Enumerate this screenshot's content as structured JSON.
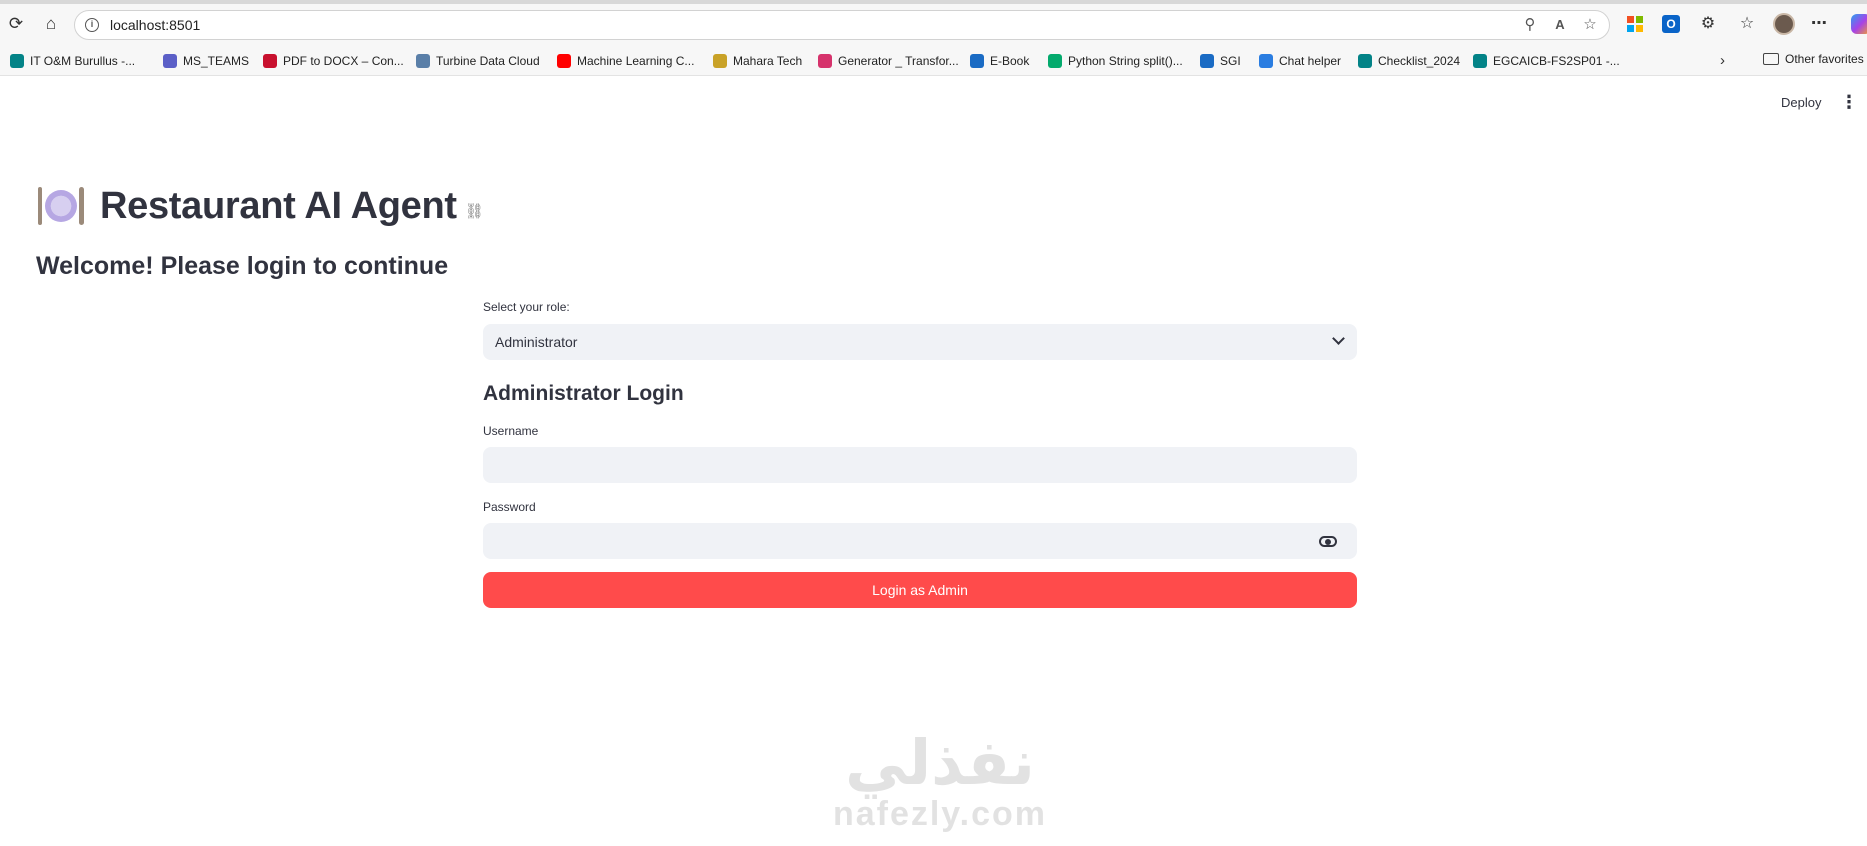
{
  "browser": {
    "url": "localhost:8501",
    "bookmarks": [
      {
        "label": "IT O&M Burullus -...",
        "icon": "sharepoint-icon",
        "color": "#038387"
      },
      {
        "label": "MS_TEAMS",
        "icon": "teams-icon",
        "color": "#5b5fc7"
      },
      {
        "label": "PDF to DOCX – Con...",
        "icon": "pdf-icon",
        "color": "#c8102e"
      },
      {
        "label": "Turbine Data Cloud",
        "icon": "image-icon",
        "color": "#5a7fa8"
      },
      {
        "label": "Machine Learning C...",
        "icon": "youtube-icon",
        "color": "#ff0000"
      },
      {
        "label": "Mahara Tech",
        "icon": "mahara-icon",
        "color": "#c9a227"
      },
      {
        "label": "Generator _ Transfor...",
        "icon": "play-icon",
        "color": "#d6336c"
      },
      {
        "label": "E-Book",
        "icon": "globe-icon",
        "color": "#1a6bc4"
      },
      {
        "label": "Python String split()...",
        "icon": "w3schools-icon",
        "color": "#04aa6d"
      },
      {
        "label": "SGI",
        "icon": "globe-icon",
        "color": "#1a6bc4"
      },
      {
        "label": "Chat helper",
        "icon": "bing-icon",
        "color": "#2a7de1"
      },
      {
        "label": "Checklist_2024",
        "icon": "sharepoint-icon",
        "color": "#038387"
      },
      {
        "label": "EGCAICB-FS2SP01 -...",
        "icon": "sharepoint-icon",
        "color": "#038387"
      }
    ],
    "other_favorites": "Other favorites"
  },
  "header": {
    "deploy_label": "Deploy"
  },
  "page": {
    "title": "Restaurant AI Agent",
    "welcome": "Welcome! Please login to continue"
  },
  "form": {
    "role_label": "Select your role:",
    "role_value": "Administrator",
    "subheading": "Administrator Login",
    "username_label": "Username",
    "username_value": "",
    "password_label": "Password",
    "password_value": "",
    "submit_label": "Login as Admin"
  },
  "watermark": {
    "arabic": "نفذلي",
    "latin": "nafezly.com"
  }
}
